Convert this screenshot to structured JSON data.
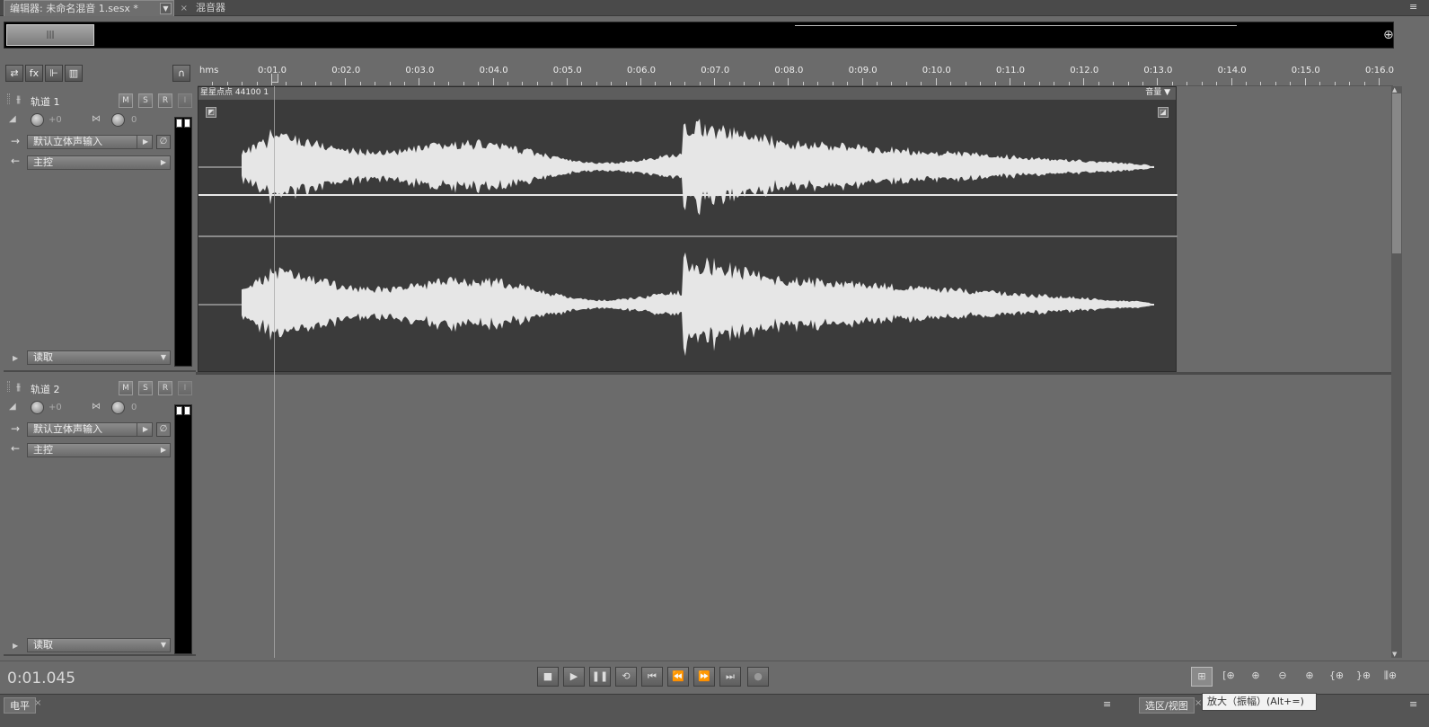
{
  "tabs": {
    "editor_label": "编辑器: 未命名混音 1.sesx *",
    "editor_dropdown": "▼",
    "close": "×",
    "mixer_label": "混音器"
  },
  "menu_icon": "≡",
  "overview": {
    "thumb_grip": "|||",
    "zoom_icon": "⊕"
  },
  "toolbar": {
    "swap_icon": "⇄",
    "fx_icon": "fx",
    "send_icon": "⊩",
    "eq_icon": "▥",
    "headphones_icon": "∩"
  },
  "ruler": {
    "unit": "hms",
    "ticks": [
      "0:01.0",
      "0:02.0",
      "0:03.0",
      "0:04.0",
      "0:05.0",
      "0:06.0",
      "0:07.0",
      "0:08.0",
      "0:09.0",
      "0:10.0",
      "0:11.0",
      "0:12.0",
      "0:13.0",
      "0:14.0",
      "0:15.0",
      "0:16.0"
    ]
  },
  "tracks": [
    {
      "name": "轨道 1",
      "m": "M",
      "s": "S",
      "r": "R",
      "i": "I",
      "volume": "+0",
      "pan": "0",
      "input": "默认立体声输入",
      "output": "主控",
      "automation": "读取"
    },
    {
      "name": "轨道 2",
      "m": "M",
      "s": "S",
      "r": "R",
      "i": "I",
      "volume": "+0",
      "pan": "0",
      "input": "默认立体声输入",
      "output": "主控",
      "automation": "读取"
    }
  ],
  "clip": {
    "title": "星星点点 44100 1",
    "volume_label": "音量 ▼"
  },
  "timecode": "0:01.045",
  "transport": {
    "stop": "■",
    "play": "▶",
    "pause": "❚❚",
    "loop": "⟲",
    "to_start": "⏮",
    "rewind": "⏪",
    "forward": "⏩",
    "to_end": "⏭",
    "record": "●"
  },
  "zoom_buttons": [
    "⊞",
    "[⊕",
    "⊕",
    "⊖",
    "⊕",
    "{⊕",
    "}⊕",
    "⫼⊕"
  ],
  "bottom_panels": {
    "level_label": "电平",
    "level_close": "×",
    "selection_label": "选区/视图",
    "selection_close": "×"
  },
  "tooltip": "放大（振幅）(Alt+=)"
}
